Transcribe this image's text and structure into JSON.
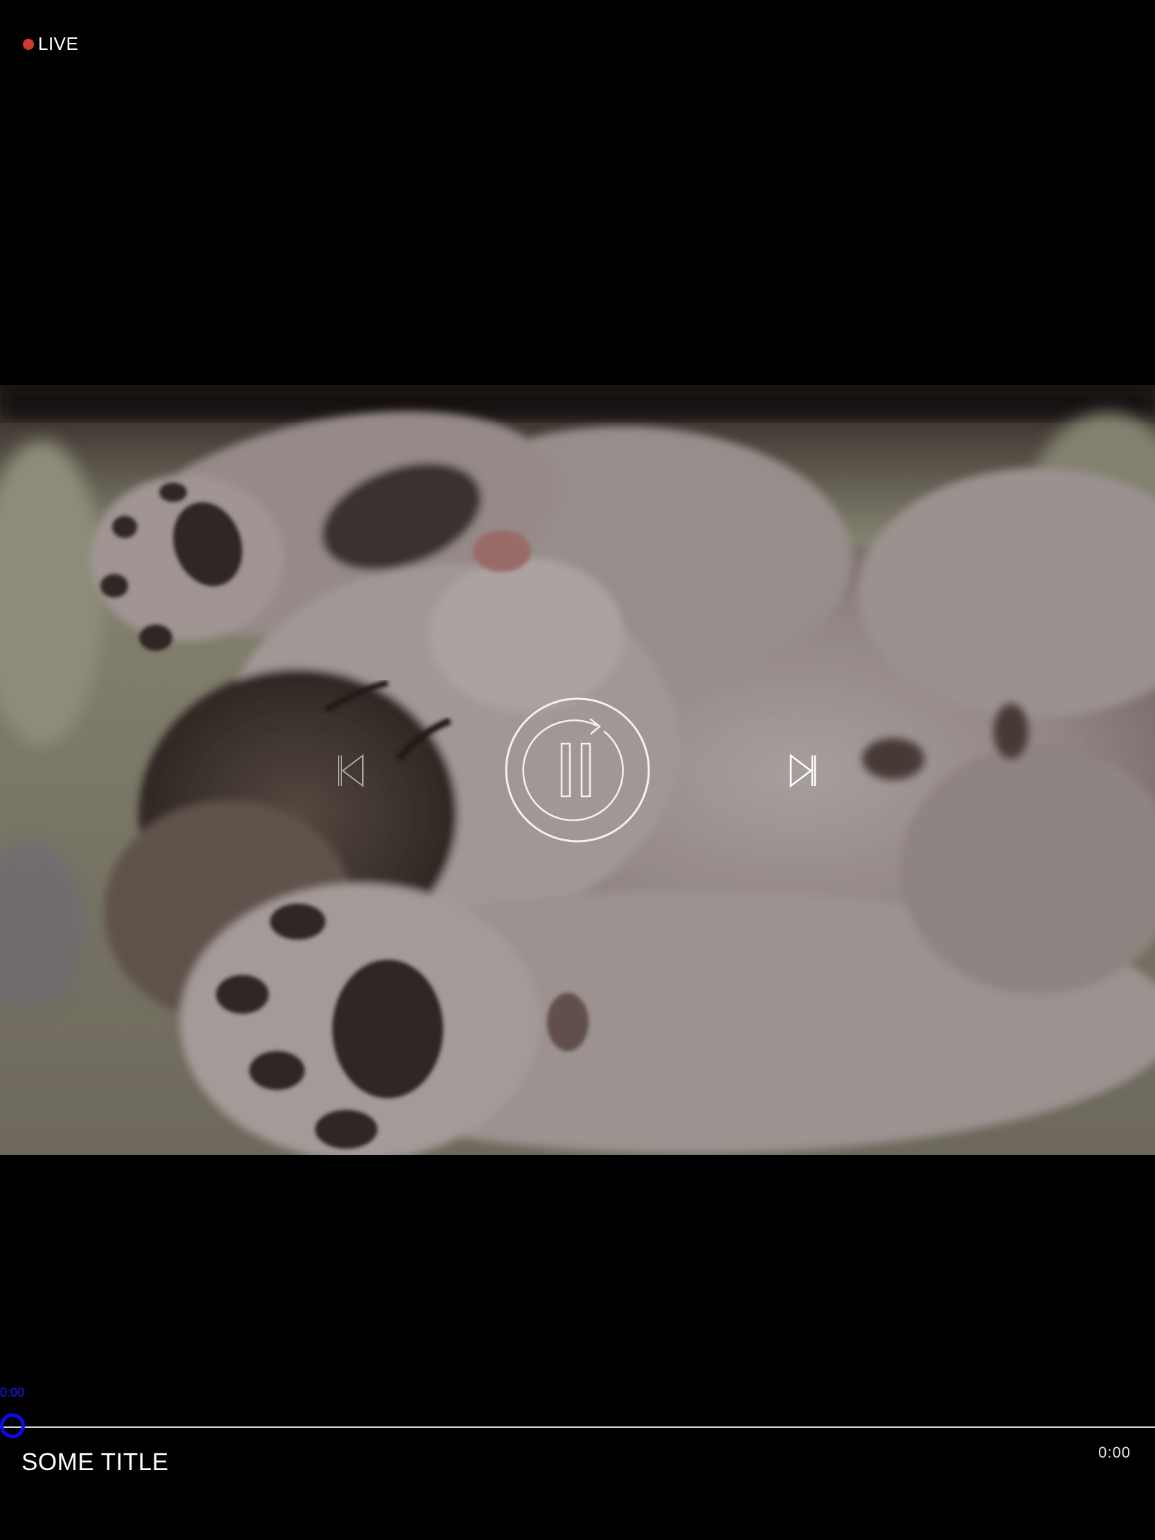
{
  "live_badge": {
    "label": "LIVE",
    "dot_color": "#d23a2a"
  },
  "video": {
    "content": "kitten sleeping on its back"
  },
  "controls": {
    "previous_icon": "skip-previous-icon",
    "play_pause_icon": "pause-circle-icon",
    "next_icon": "skip-next-icon"
  },
  "progress": {
    "current_time": "0:00",
    "total_time": "0:00",
    "fraction": 0,
    "accent_color": "#0b0bf0"
  },
  "media": {
    "title": "SOME TITLE"
  }
}
